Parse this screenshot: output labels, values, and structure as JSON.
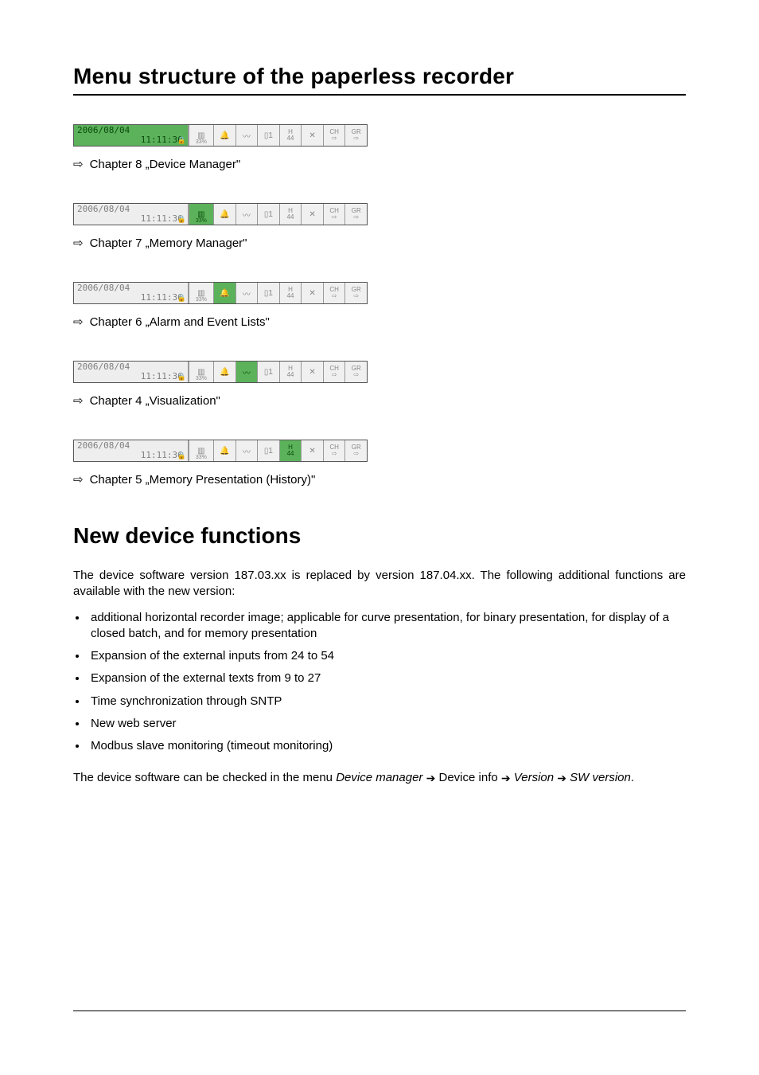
{
  "page_title": "Menu structure of the paperless recorder",
  "section_heading": "New device functions",
  "timestamp": {
    "date": "2006/08/04",
    "time": "11:11:36"
  },
  "toolbar_common": {
    "pct": "33%",
    "h_top": "H",
    "h_bot": "44",
    "ch": "CH",
    "gr": "GR"
  },
  "chapters": [
    {
      "text": "Chapter 8 „Device Manager\""
    },
    {
      "text": "Chapter 7 „Memory Manager\""
    },
    {
      "text": "Chapter 6 „Alarm and Event Lists\""
    },
    {
      "text": "Chapter 4 „Visualization\""
    },
    {
      "text": "Chapter 5 „Memory Presentation (History)\""
    }
  ],
  "intro_paragraph": "The device software version 187.03.xx is replaced by version 187.04.xx. The following additional functions are available with the new version:",
  "feature_list": [
    "additional horizontal recorder image; applicable for curve presentation, for binary presentation, for display of a closed batch, and for memory presentation",
    "Expansion of the external inputs from 24 to 54",
    "Expansion of the external texts from 9 to 27",
    "Time synchronization through SNTP",
    "New web server",
    "Modbus slave monitoring (timeout monitoring)"
  ],
  "closing_paragraph_parts": {
    "pre": "The device software can be checked in the menu ",
    "dm": "Device manager",
    "arrow": "➔",
    "di": " Device info ",
    "ver": "Version",
    "sw": "SW version",
    "period": "."
  }
}
